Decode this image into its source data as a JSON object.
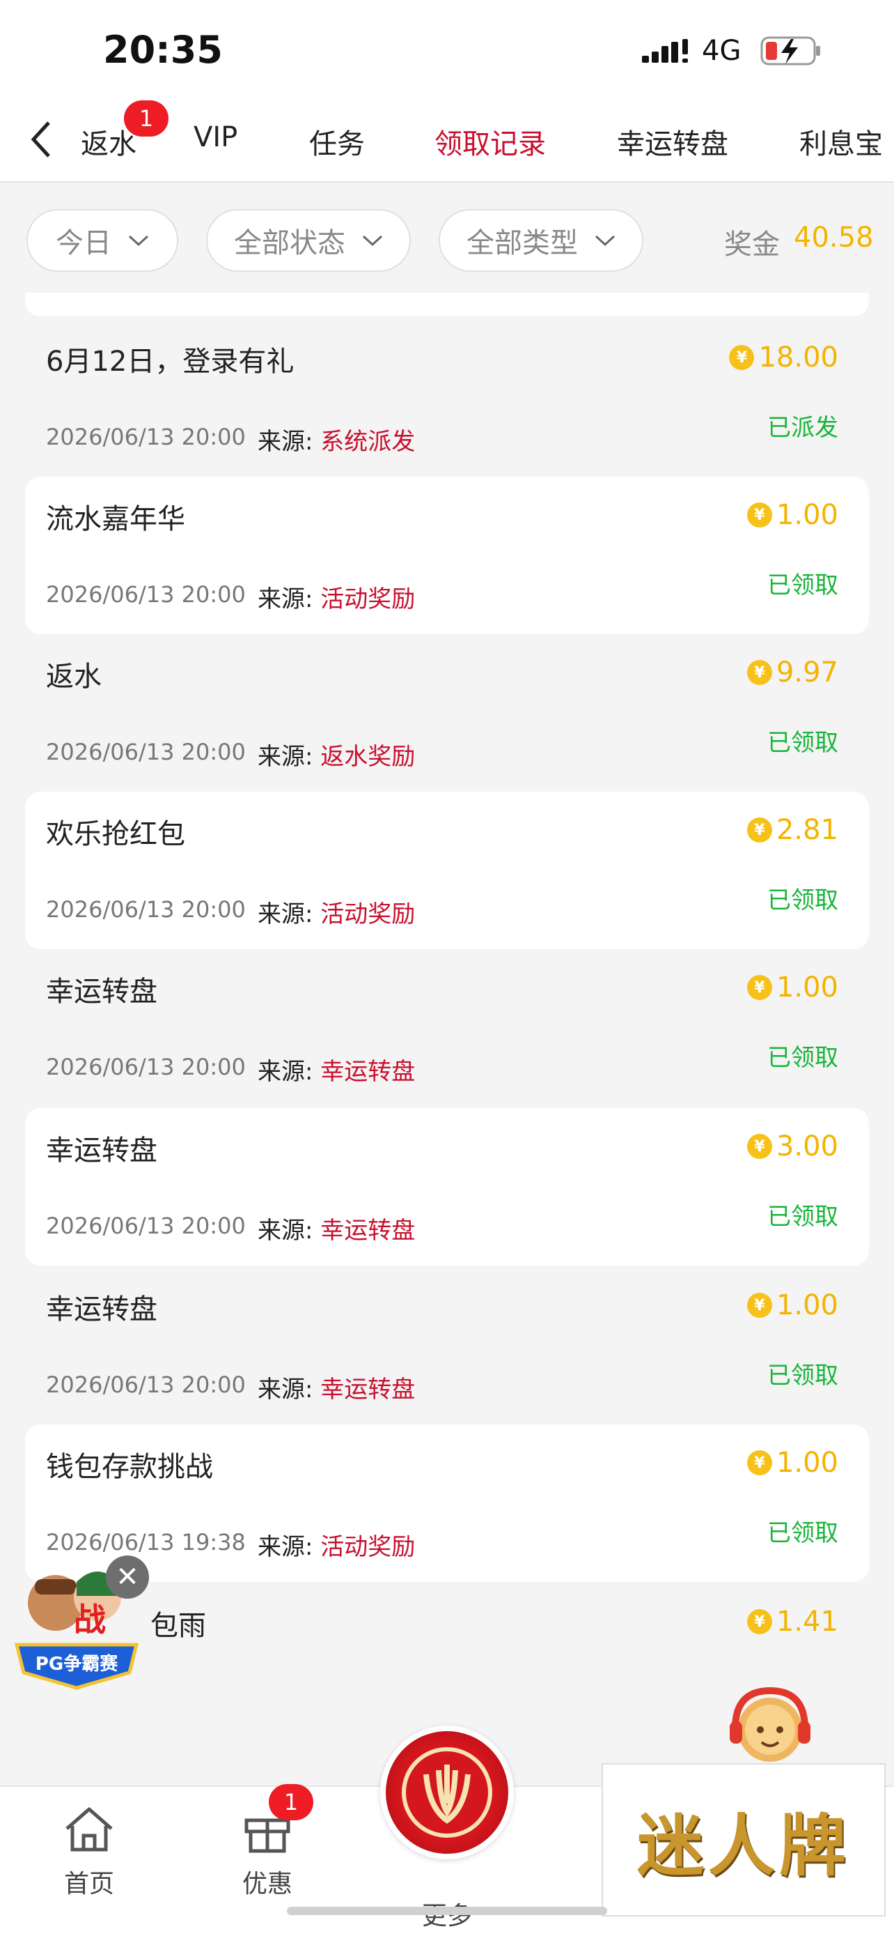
{
  "status_bar": {
    "time": "20:35",
    "network": "4G"
  },
  "tabs": [
    {
      "label": "返水",
      "badge": "1"
    },
    {
      "label": "VIP"
    },
    {
      "label": "任务"
    },
    {
      "label": "领取记录",
      "active": true
    },
    {
      "label": "幸运转盘"
    },
    {
      "label": "利息宝"
    }
  ],
  "filters": {
    "date": "今日",
    "status": "全部状态",
    "type": "全部类型"
  },
  "prize": {
    "label": "奖金",
    "value": "40.58"
  },
  "source_prefix": "来源:",
  "records": [
    {
      "title": "6月12日，登录有礼",
      "amount": "18.00",
      "time": "2026/06/13 20:00",
      "source": "系统派发",
      "status": "已派发"
    },
    {
      "title": "流水嘉年华",
      "amount": "1.00",
      "time": "2026/06/13 20:00",
      "source": "活动奖励",
      "status": "已领取"
    },
    {
      "title": "返水",
      "amount": "9.97",
      "time": "2026/06/13 20:00",
      "source": "返水奖励",
      "status": "已领取"
    },
    {
      "title": "欢乐抢红包",
      "amount": "2.81",
      "time": "2026/06/13 20:00",
      "source": "活动奖励",
      "status": "已领取"
    },
    {
      "title": "幸运转盘",
      "amount": "1.00",
      "time": "2026/06/13 20:00",
      "source": "幸运转盘",
      "status": "已领取"
    },
    {
      "title": "幸运转盘",
      "amount": "3.00",
      "time": "2026/06/13 20:00",
      "source": "幸运转盘",
      "status": "已领取"
    },
    {
      "title": "幸运转盘",
      "amount": "1.00",
      "time": "2026/06/13 20:00",
      "source": "幸运转盘",
      "status": "已领取"
    },
    {
      "title": "钱包存款挑战",
      "amount": "1.00",
      "time": "2026/06/13 19:38",
      "source": "活动奖励",
      "status": "已领取"
    },
    {
      "title": "包雨",
      "amount": "1.41"
    }
  ],
  "floating": {
    "pg_label": "PG争霸赛"
  },
  "bottom_nav": [
    {
      "label": "首页"
    },
    {
      "label": "优惠",
      "badge": "1"
    },
    {
      "label": "更多"
    }
  ],
  "brand": "迷人牌",
  "colors": {
    "accent": "#c8102e",
    "gold": "#f3b400",
    "success": "#17b53a"
  }
}
